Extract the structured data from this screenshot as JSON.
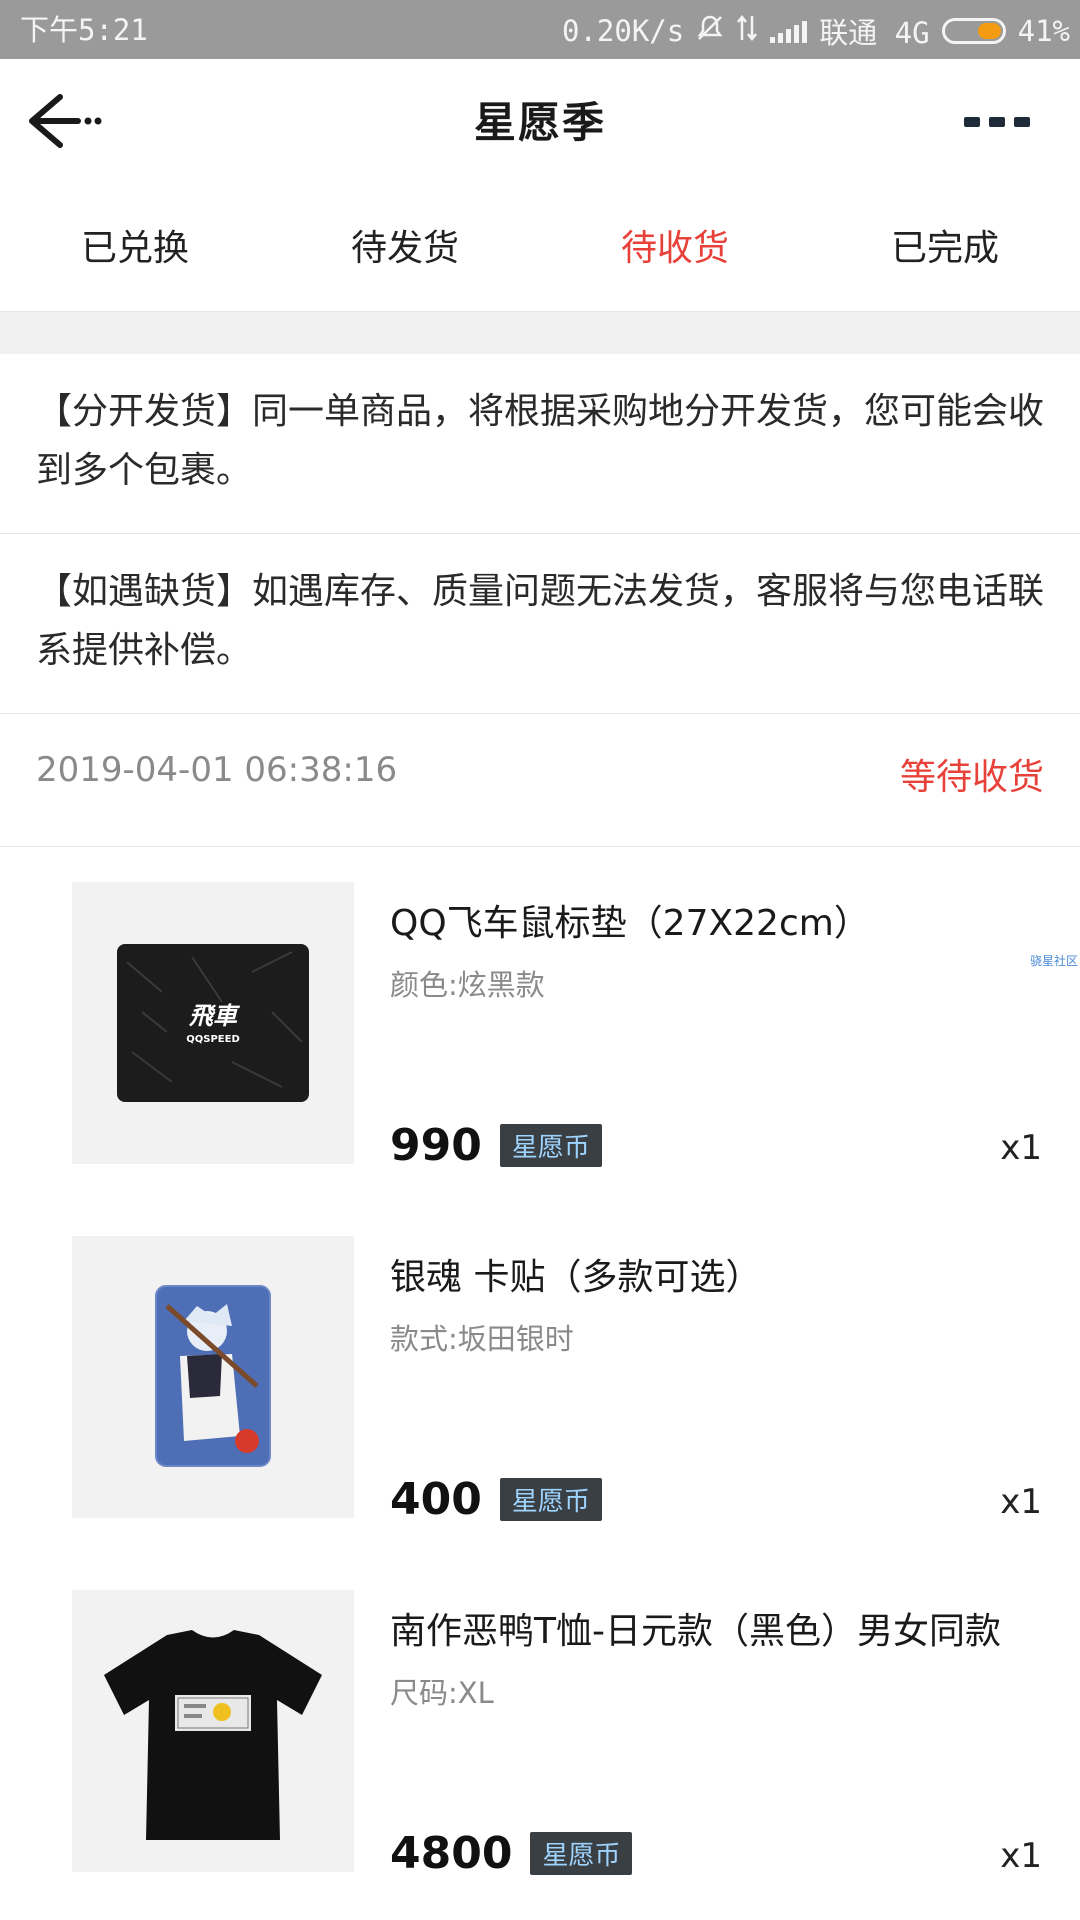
{
  "status_bar": {
    "time": "下午5:21",
    "network_speed": "0.20K/s",
    "carrier": "联通 4G",
    "battery_percent": "41%",
    "battery_level": 0.41
  },
  "nav": {
    "title": "星愿季"
  },
  "tabs": [
    {
      "label": "已兑换"
    },
    {
      "label": "待发货"
    },
    {
      "label": "待收货",
      "active": true
    },
    {
      "label": "已完成"
    }
  ],
  "notices": [
    "【分开发货】同一单商品，将根据采购地分开发货，您可能会收到多个包裹。",
    "【如遇缺货】如遇库存、质量问题无法发货，客服将与您电话联系提供补偿。"
  ],
  "order": {
    "time": "2019-04-01 06:38:16",
    "status": "等待收货"
  },
  "items": [
    {
      "title": "QQ飞车鼠标垫（27X22cm）",
      "spec": "颜色:炫黑款",
      "price": "990",
      "currency": "星愿币",
      "qty": "x1"
    },
    {
      "title": "银魂 卡贴（多款可选）",
      "spec": "款式:坂田银时",
      "price": "400",
      "currency": "星愿币",
      "qty": "x1"
    },
    {
      "title": "南作恶鸭T恤-日元款（黑色）男女同款",
      "spec": "尺码:XL",
      "price": "4800",
      "currency": "星愿币",
      "qty": "x1"
    }
  ],
  "thumb_labels": {
    "mousepad_logo_line1": "飛車",
    "mousepad_logo_line2": "QQSPEED"
  },
  "watermark": "骁星社区",
  "colors": {
    "accent_red": "#e8413a",
    "status_bar_bg": "#9a9a9a",
    "battery_fill": "#f39c12",
    "badge_bg": "#3a3f44"
  }
}
